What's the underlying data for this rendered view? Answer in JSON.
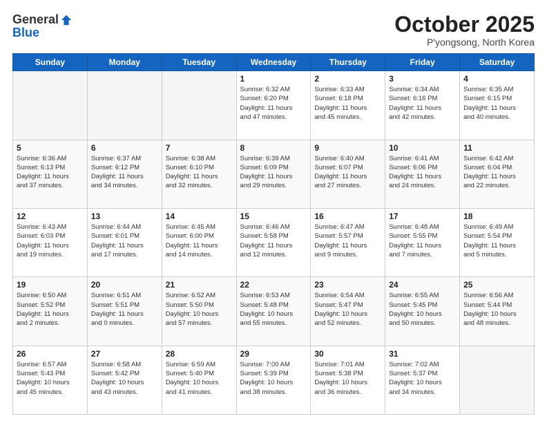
{
  "logo": {
    "general": "General",
    "blue": "Blue"
  },
  "header": {
    "month": "October 2025",
    "location": "P'yongsong, North Korea"
  },
  "weekdays": [
    "Sunday",
    "Monday",
    "Tuesday",
    "Wednesday",
    "Thursday",
    "Friday",
    "Saturday"
  ],
  "weeks": [
    [
      {
        "day": "",
        "info": ""
      },
      {
        "day": "",
        "info": ""
      },
      {
        "day": "",
        "info": ""
      },
      {
        "day": "1",
        "info": "Sunrise: 6:32 AM\nSunset: 6:20 PM\nDaylight: 11 hours\nand 47 minutes."
      },
      {
        "day": "2",
        "info": "Sunrise: 6:33 AM\nSunset: 6:18 PM\nDaylight: 11 hours\nand 45 minutes."
      },
      {
        "day": "3",
        "info": "Sunrise: 6:34 AM\nSunset: 6:16 PM\nDaylight: 11 hours\nand 42 minutes."
      },
      {
        "day": "4",
        "info": "Sunrise: 6:35 AM\nSunset: 6:15 PM\nDaylight: 11 hours\nand 40 minutes."
      }
    ],
    [
      {
        "day": "5",
        "info": "Sunrise: 6:36 AM\nSunset: 6:13 PM\nDaylight: 11 hours\nand 37 minutes."
      },
      {
        "day": "6",
        "info": "Sunrise: 6:37 AM\nSunset: 6:12 PM\nDaylight: 11 hours\nand 34 minutes."
      },
      {
        "day": "7",
        "info": "Sunrise: 6:38 AM\nSunset: 6:10 PM\nDaylight: 11 hours\nand 32 minutes."
      },
      {
        "day": "8",
        "info": "Sunrise: 6:39 AM\nSunset: 6:09 PM\nDaylight: 11 hours\nand 29 minutes."
      },
      {
        "day": "9",
        "info": "Sunrise: 6:40 AM\nSunset: 6:07 PM\nDaylight: 11 hours\nand 27 minutes."
      },
      {
        "day": "10",
        "info": "Sunrise: 6:41 AM\nSunset: 6:06 PM\nDaylight: 11 hours\nand 24 minutes."
      },
      {
        "day": "11",
        "info": "Sunrise: 6:42 AM\nSunset: 6:04 PM\nDaylight: 11 hours\nand 22 minutes."
      }
    ],
    [
      {
        "day": "12",
        "info": "Sunrise: 6:43 AM\nSunset: 6:03 PM\nDaylight: 11 hours\nand 19 minutes."
      },
      {
        "day": "13",
        "info": "Sunrise: 6:44 AM\nSunset: 6:01 PM\nDaylight: 11 hours\nand 17 minutes."
      },
      {
        "day": "14",
        "info": "Sunrise: 6:45 AM\nSunset: 6:00 PM\nDaylight: 11 hours\nand 14 minutes."
      },
      {
        "day": "15",
        "info": "Sunrise: 6:46 AM\nSunset: 5:58 PM\nDaylight: 11 hours\nand 12 minutes."
      },
      {
        "day": "16",
        "info": "Sunrise: 6:47 AM\nSunset: 5:57 PM\nDaylight: 11 hours\nand 9 minutes."
      },
      {
        "day": "17",
        "info": "Sunrise: 6:48 AM\nSunset: 5:55 PM\nDaylight: 11 hours\nand 7 minutes."
      },
      {
        "day": "18",
        "info": "Sunrise: 6:49 AM\nSunset: 5:54 PM\nDaylight: 11 hours\nand 5 minutes."
      }
    ],
    [
      {
        "day": "19",
        "info": "Sunrise: 6:50 AM\nSunset: 5:52 PM\nDaylight: 11 hours\nand 2 minutes."
      },
      {
        "day": "20",
        "info": "Sunrise: 6:51 AM\nSunset: 5:51 PM\nDaylight: 11 hours\nand 0 minutes."
      },
      {
        "day": "21",
        "info": "Sunrise: 6:52 AM\nSunset: 5:50 PM\nDaylight: 10 hours\nand 57 minutes."
      },
      {
        "day": "22",
        "info": "Sunrise: 6:53 AM\nSunset: 5:48 PM\nDaylight: 10 hours\nand 55 minutes."
      },
      {
        "day": "23",
        "info": "Sunrise: 6:54 AM\nSunset: 5:47 PM\nDaylight: 10 hours\nand 52 minutes."
      },
      {
        "day": "24",
        "info": "Sunrise: 6:55 AM\nSunset: 5:45 PM\nDaylight: 10 hours\nand 50 minutes."
      },
      {
        "day": "25",
        "info": "Sunrise: 6:56 AM\nSunset: 5:44 PM\nDaylight: 10 hours\nand 48 minutes."
      }
    ],
    [
      {
        "day": "26",
        "info": "Sunrise: 6:57 AM\nSunset: 5:43 PM\nDaylight: 10 hours\nand 45 minutes."
      },
      {
        "day": "27",
        "info": "Sunrise: 6:58 AM\nSunset: 5:42 PM\nDaylight: 10 hours\nand 43 minutes."
      },
      {
        "day": "28",
        "info": "Sunrise: 6:59 AM\nSunset: 5:40 PM\nDaylight: 10 hours\nand 41 minutes."
      },
      {
        "day": "29",
        "info": "Sunrise: 7:00 AM\nSunset: 5:39 PM\nDaylight: 10 hours\nand 38 minutes."
      },
      {
        "day": "30",
        "info": "Sunrise: 7:01 AM\nSunset: 5:38 PM\nDaylight: 10 hours\nand 36 minutes."
      },
      {
        "day": "31",
        "info": "Sunrise: 7:02 AM\nSunset: 5:37 PM\nDaylight: 10 hours\nand 34 minutes."
      },
      {
        "day": "",
        "info": ""
      }
    ]
  ]
}
